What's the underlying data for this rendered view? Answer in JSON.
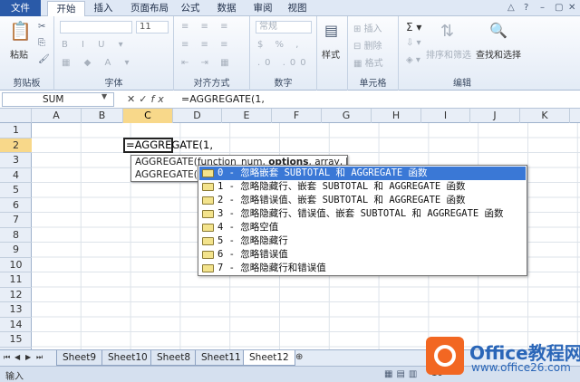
{
  "tabs": [
    "文件",
    "开始",
    "插入",
    "页面布局",
    "公式",
    "数据",
    "审阅",
    "视图"
  ],
  "ribbon": {
    "clipboard": {
      "label": "剪贴板",
      "paste": "粘贴"
    },
    "font": {
      "label": "字体",
      "size": "11"
    },
    "align": {
      "label": "对齐方式"
    },
    "number": {
      "label": "数字",
      "format": "常规"
    },
    "styles": {
      "label": "样式"
    },
    "cells": {
      "label": "单元格",
      "insert": "插入",
      "delete": "删除",
      "format": "格式"
    },
    "edit": {
      "label": "编辑",
      "sort": "排序和筛选",
      "find": "查找和选择"
    }
  },
  "formula_bar": {
    "name_box": "SUM",
    "fx": "fx",
    "formula": "=AGGREGATE(1,"
  },
  "columns": [
    "A",
    "B",
    "C",
    "D",
    "E",
    "F",
    "G",
    "H",
    "I",
    "J",
    "K"
  ],
  "rows": [
    "1",
    "2",
    "3",
    "4",
    "5",
    "6",
    "7",
    "8",
    "9",
    "10",
    "11",
    "12",
    "13",
    "14",
    "15"
  ],
  "cell_C2": "=AGGREGATE(1,",
  "tooltip": {
    "line1_prefix": "AGGREGATE(function_num, ",
    "line1_bold": "options",
    "line1_suffix": ", array, [k])",
    "line2": "AGGREGATE(f"
  },
  "dropdown": [
    "0 - 忽略嵌套 SUBTOTAL 和 AGGREGATE 函数",
    "1 - 忽略隐藏行、嵌套 SUBTOTAL 和 AGGREGATE 函数",
    "2 - 忽略错误值、嵌套 SUBTOTAL 和 AGGREGATE 函数",
    "3 - 忽略隐藏行、错误值、嵌套 SUBTOTAL 和 AGGREGATE 函数",
    "4 - 忽略空值",
    "5 - 忽略隐藏行",
    "6 - 忽略错误值",
    "7 - 忽略隐藏行和错误值"
  ],
  "sheets": [
    "Sheet9",
    "Sheet10",
    "Sheet8",
    "Sheet11",
    "Sheet12"
  ],
  "active_sheet": "Sheet12",
  "status": {
    "mode": "输入",
    "zoom": "10"
  },
  "watermark": {
    "title": "Office教程网",
    "url": "www.office26.com"
  },
  "colors": {
    "file_tab": "#2a5aa8",
    "selection": "#3a78d6",
    "header_sel": "#f8d88a",
    "logo": "#f26722"
  }
}
